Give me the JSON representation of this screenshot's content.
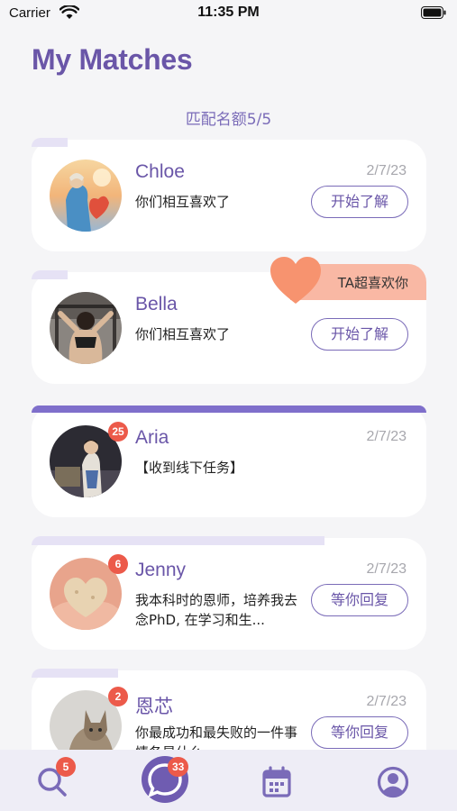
{
  "status_bar": {
    "carrier": "Carrier",
    "time": "11:35 PM"
  },
  "page_title": "My Matches",
  "quota": "匹配名额5/5",
  "matches": [
    {
      "name": "Chloe",
      "date": "2/7/23",
      "message": "你们相互喜欢了",
      "button": "开始了解",
      "badge": ""
    },
    {
      "name": "Bella",
      "date": "",
      "message": "你们相互喜欢了",
      "button": "开始了解",
      "badge": "",
      "tag": "TA超喜欢你"
    },
    {
      "name": "Aria",
      "date": "2/7/23",
      "message": "【收到线下任务】",
      "button": "",
      "badge": "25"
    },
    {
      "name": "Jenny",
      "date": "2/7/23",
      "message": "我本科时的恩师，培养我去念PhD, 在学习和生...",
      "button": "等你回复",
      "badge": "6"
    },
    {
      "name": "恩芯",
      "date": "2/7/23",
      "message": "你最成功和最失败的一件事情各是什么",
      "button": "等你回复",
      "badge": "2"
    }
  ],
  "tab_bar": {
    "discover_badge": "5",
    "chat_badge": "33"
  },
  "colors": {
    "accent": "#6a56a8",
    "badge": "#ec5a4a",
    "tag": "#f9b8a4",
    "heart": "#f7936f"
  }
}
